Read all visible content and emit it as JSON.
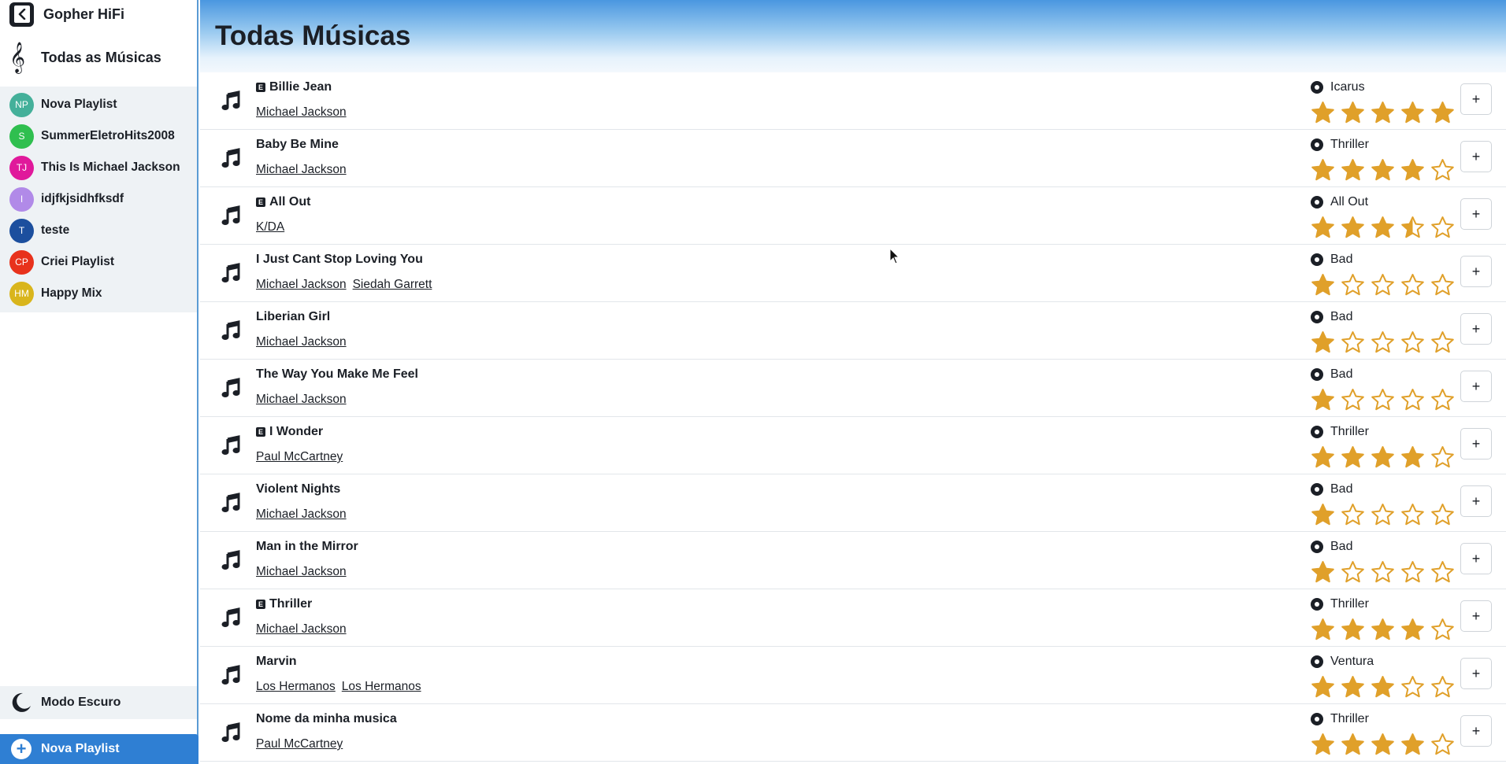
{
  "app": {
    "title": "Gopher HiFi"
  },
  "sidebar": {
    "all_songs_label": "Todas as Músicas",
    "playlists": [
      {
        "initials": "NP",
        "label": "Nova Playlist",
        "color": "#44b09a"
      },
      {
        "initials": "S",
        "label": "SummerEletroHits2008",
        "color": "#2fbf4f"
      },
      {
        "initials": "TJ",
        "label": "This Is Michael Jackson",
        "color": "#e0199b"
      },
      {
        "initials": "I",
        "label": "idjfkjsidhfksdf",
        "color": "#b18ae8"
      },
      {
        "initials": "T",
        "label": "teste",
        "color": "#1c4f9e"
      },
      {
        "initials": "CP",
        "label": "Criei Playlist",
        "color": "#e8321c"
      },
      {
        "initials": "HM",
        "label": "Happy Mix",
        "color": "#d9b51c"
      }
    ],
    "dark_mode_label": "Modo Escuro",
    "new_playlist_label": "Nova Playlist"
  },
  "main": {
    "title": "Todas Músicas",
    "add_label": "+",
    "songs": [
      {
        "title": "Billie Jean",
        "explicit": true,
        "artists": [
          "Michael Jackson"
        ],
        "album": "Icarus",
        "rating": 5
      },
      {
        "title": "Baby Be Mine",
        "explicit": false,
        "artists": [
          "Michael Jackson"
        ],
        "album": "Thriller",
        "rating": 4
      },
      {
        "title": "All Out",
        "explicit": true,
        "artists": [
          "K/DA"
        ],
        "album": "All Out",
        "rating": 3.5
      },
      {
        "title": "I Just Cant Stop Loving You",
        "explicit": false,
        "artists": [
          "Michael Jackson",
          "Siedah Garrett"
        ],
        "album": "Bad",
        "rating": 1
      },
      {
        "title": "Liberian Girl",
        "explicit": false,
        "artists": [
          "Michael Jackson"
        ],
        "album": "Bad",
        "rating": 1
      },
      {
        "title": "The Way You Make Me Feel",
        "explicit": false,
        "artists": [
          "Michael Jackson"
        ],
        "album": "Bad",
        "rating": 1
      },
      {
        "title": "I Wonder",
        "explicit": true,
        "artists": [
          "Paul McCartney"
        ],
        "album": "Thriller",
        "rating": 4
      },
      {
        "title": "Violent Nights",
        "explicit": false,
        "artists": [
          "Michael Jackson"
        ],
        "album": "Bad",
        "rating": 1
      },
      {
        "title": "Man in the Mirror",
        "explicit": false,
        "artists": [
          "Michael Jackson"
        ],
        "album": "Bad",
        "rating": 1
      },
      {
        "title": "Thriller",
        "explicit": true,
        "artists": [
          "Michael Jackson"
        ],
        "album": "Thriller",
        "rating": 4
      },
      {
        "title": "Marvin",
        "explicit": false,
        "artists": [
          "Los Hermanos",
          "Los Hermanos"
        ],
        "album": "Ventura",
        "rating": 3
      },
      {
        "title": "Nome da minha musica",
        "explicit": false,
        "artists": [
          "Paul McCartney"
        ],
        "album": "Thriller",
        "rating": 4
      }
    ]
  },
  "colors": {
    "star": "#e0a02a",
    "accent": "#2f7fd3"
  }
}
